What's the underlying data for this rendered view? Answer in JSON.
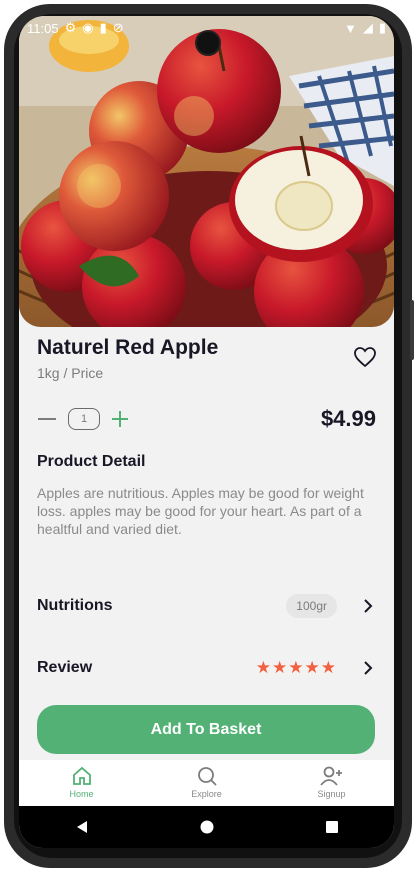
{
  "status_bar": {
    "time": "11:05"
  },
  "product": {
    "name": "Naturel Red Apple",
    "unit": "1kg / Price",
    "quantity": "1",
    "price": "$4.99"
  },
  "detail": {
    "heading": "Product Detail",
    "text": "Apples are nutritious. Apples may be good for weight loss. apples may be good for your heart. As part of a healtful and varied diet."
  },
  "nutritions": {
    "label": "Nutritions",
    "value": "100gr"
  },
  "review": {
    "label": "Review",
    "stars": "★★★★★",
    "rating": 5
  },
  "cta": {
    "label": "Add To Basket"
  },
  "nav": {
    "items": [
      {
        "label": "Home",
        "icon": "home-icon",
        "active": true
      },
      {
        "label": "Explore",
        "icon": "search-icon",
        "active": false
      },
      {
        "label": "Signup",
        "icon": "add-user-icon",
        "active": false
      }
    ]
  },
  "colors": {
    "accent": "#53b175",
    "star": "#f3603f",
    "text": "#181725",
    "muted": "#7c7c7c"
  }
}
